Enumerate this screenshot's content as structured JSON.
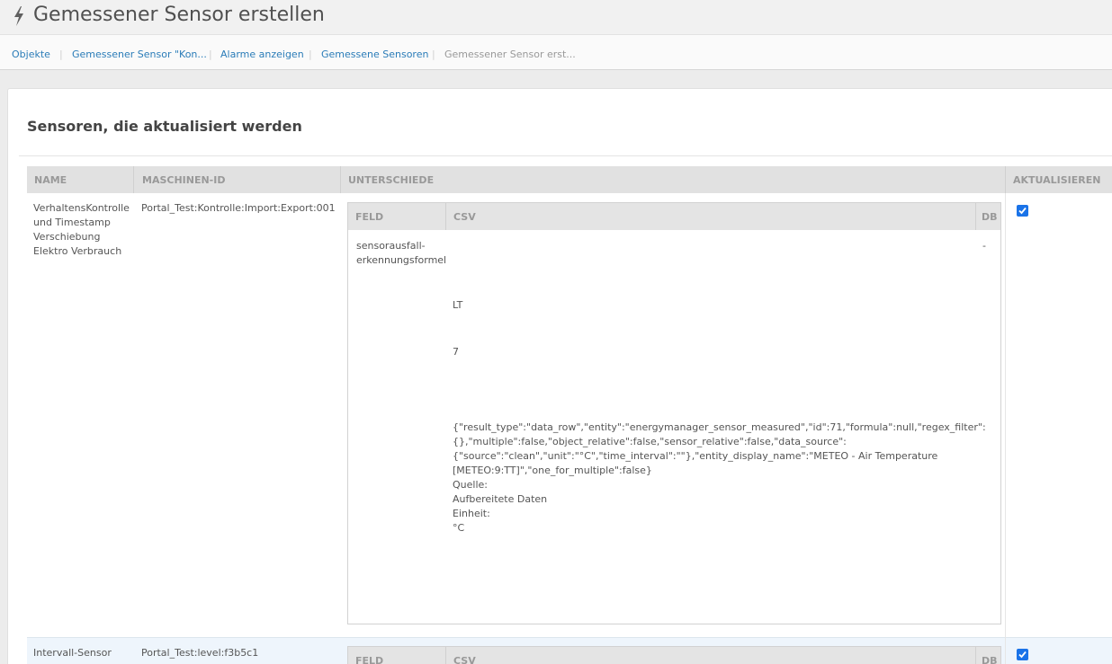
{
  "header": {
    "title": "Gemessener Sensor erstellen",
    "icon": "bolt-icon"
  },
  "breadcrumbs": [
    {
      "label": "Objekte"
    },
    {
      "label": "Gemessener Sensor \"Kon..."
    },
    {
      "label": "Alarme anzeigen"
    },
    {
      "label": "Gemessene Sensoren"
    },
    {
      "label": "Gemessener Sensor erst..."
    }
  ],
  "section": {
    "title": "Sensoren, die aktualisiert werden"
  },
  "table": {
    "columns": {
      "name": "NAME",
      "machine_id": "MASCHINEN-ID",
      "differences": "UNTERSCHIEDE",
      "update": "AKTUALISIEREN"
    },
    "diff_columns": {
      "field": "FELD",
      "csv": "CSV",
      "db": "DB"
    },
    "rows": [
      {
        "name": "VerhaltensKontrolle\nund Timestamp\nVerschiebung\nElektro Verbrauch",
        "machine_id": "Portal_Test:Kontrolle:Import:Export:001",
        "checked": true,
        "diff": {
          "field": "sensorausfall-\nerkennungsformel",
          "db": "-",
          "csv_lines": {
            "a": "LT",
            "b": "7",
            "json": "{\"result_type\":\"data_row\",\"entity\":\"energymanager_sensor_measured\",\"id\":71,\"formula\":null,\"regex_filter\":{},\"multiple\":false,\"object_relative\":false,\"sensor_relative\":false,\"data_source\":{\"source\":\"clean\",\"unit\":\"°C\",\"time_interval\":\"\"},\"entity_display_name\":\"METEO - Air Temperature [METEO:9:TT]\",\"one_for_multiple\":false}",
            "source_label": "Quelle:",
            "source_value": "Aufbereitete Daten",
            "unit_label": "Einheit:",
            "unit_value": "°C"
          }
        }
      },
      {
        "name": "Intervall-Sensor",
        "machine_id": "Portal_Test:level:f3b5c1",
        "checked": true
      }
    ]
  },
  "colors": {
    "accent": "#2a7cb8",
    "checkbox": "#1a73e8",
    "row_highlight": "#eef5fc"
  }
}
